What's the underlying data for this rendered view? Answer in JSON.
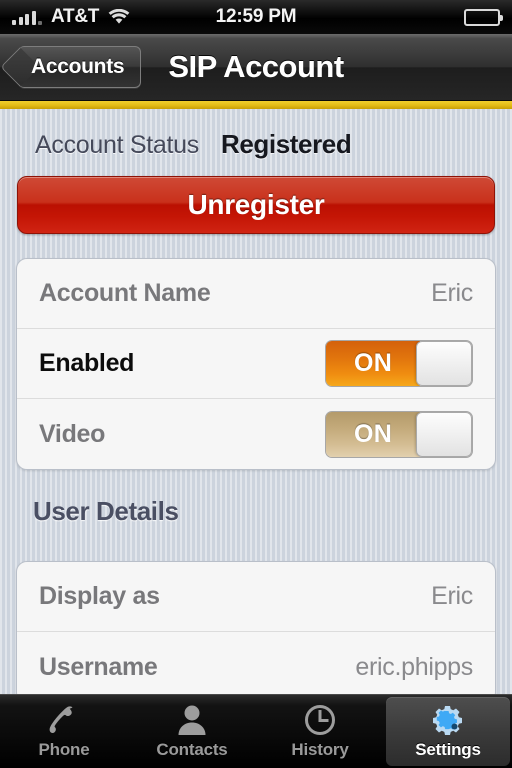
{
  "status_bar": {
    "carrier": "AT&T",
    "time": "12:59 PM",
    "signal_icon": "signal-bars-icon",
    "wifi_icon": "wifi-icon",
    "battery_icon": "battery-icon"
  },
  "nav": {
    "back_label": "Accounts",
    "title": "SIP Account",
    "accent_color": "#e3bb16"
  },
  "account_status": {
    "label": "Account Status",
    "value": "Registered"
  },
  "unregister_button": {
    "label": "Unregister",
    "color": "#bb1002"
  },
  "account_group": {
    "rows": [
      {
        "label": "Account Name",
        "value": "Eric",
        "type": "value"
      },
      {
        "label": "Enabled",
        "toggle_label": "ON",
        "type": "toggle",
        "toggle_color": "#ef8c10"
      },
      {
        "label": "Video",
        "toggle_label": "ON",
        "type": "toggle",
        "toggle_color": "#d4bd93"
      }
    ]
  },
  "user_details": {
    "header": "User Details",
    "rows": [
      {
        "label": "Display as",
        "value": "Eric"
      },
      {
        "label": "Username",
        "value": "eric.phipps"
      }
    ]
  },
  "tabbar": {
    "tabs": [
      {
        "label": "Phone",
        "icon": "phone-handset-icon",
        "active": false
      },
      {
        "label": "Contacts",
        "icon": "person-icon",
        "active": false
      },
      {
        "label": "History",
        "icon": "clock-icon",
        "active": false
      },
      {
        "label": "Settings",
        "icon": "gears-icon",
        "active": true
      }
    ]
  }
}
